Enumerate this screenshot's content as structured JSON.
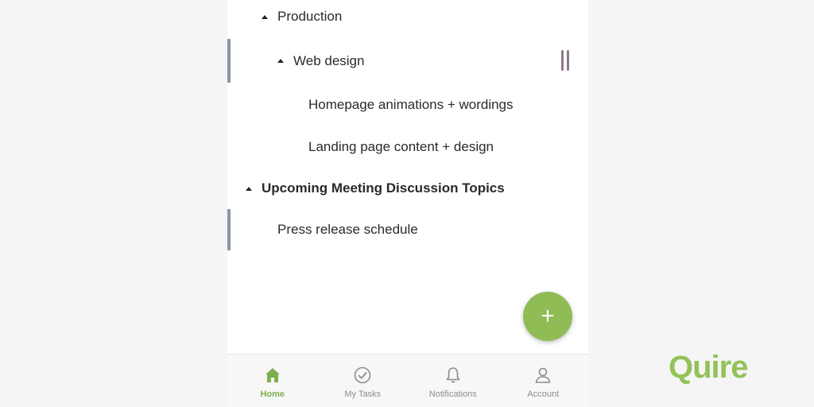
{
  "tree": [
    {
      "label": "Production",
      "bold": false,
      "expanded": true,
      "selected": false
    },
    {
      "label": "Web design",
      "bold": false,
      "expanded": true,
      "selected": true
    },
    {
      "label": "Homepage animations + wordings",
      "bold": false,
      "expanded": null,
      "selected": false
    },
    {
      "label": "Landing page content + design",
      "bold": false,
      "expanded": null,
      "selected": false
    },
    {
      "label": "Upcoming Meeting Discussion Topics",
      "bold": true,
      "expanded": true,
      "selected": false
    },
    {
      "label": "Press release schedule",
      "bold": false,
      "expanded": null,
      "selected": true
    }
  ],
  "fab": {
    "icon": "plus-icon",
    "symbol": "+"
  },
  "tabbar": {
    "tabs": [
      {
        "label": "Home",
        "icon": "home-icon",
        "active": true
      },
      {
        "label": "My Tasks",
        "icon": "check-circle-icon",
        "active": false
      },
      {
        "label": "Notifications",
        "icon": "bell-icon",
        "active": false
      },
      {
        "label": "Account",
        "icon": "person-icon",
        "active": false
      }
    ]
  },
  "brand": {
    "logo_text": "Quire",
    "color": "#93c25a"
  },
  "colors": {
    "accent": "#8fbc55",
    "active_tab": "#7fae4e",
    "selection_bar": "#8b96a3"
  }
}
